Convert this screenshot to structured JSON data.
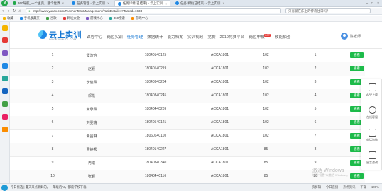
{
  "browser": {
    "tabs": [
      {
        "label": "360导航_一个主页，整个世界",
        "active": false,
        "color": "#22a84a"
      },
      {
        "label": "任务管理 - 云上实训",
        "active": false,
        "color": "#1e88e5"
      },
      {
        "label": "任务详情(已结束) - 云上实训",
        "active": true,
        "color": "#1e88e5"
      },
      {
        "label": "任务详情(已结束) - 云上实训",
        "active": false,
        "color": "#1e88e5"
      }
    ],
    "url": "http://www.yunsx.com/TeacherTaskManagement/TaskDetailes?TaskId=1033",
    "search_text": "只有躺在床上的传奇往日吗？"
  },
  "bookmarks": [
    "收藏",
    "手机收藏夹",
    "谷歌",
    "网址大全",
    "游戏中心",
    "360搜索",
    "游戏中心"
  ],
  "site": {
    "logo_text": "云上实训",
    "logo_url": "WWW.YUNSX.COM",
    "nav": [
      {
        "label": "课程中心",
        "active": false
      },
      {
        "label": "岗位实训",
        "active": false
      },
      {
        "label": "任务管理",
        "active": true
      },
      {
        "label": "数据统计",
        "active": false
      },
      {
        "label": "能力档案",
        "active": false
      },
      {
        "label": "实训视频",
        "active": false
      },
      {
        "label": "竞赛",
        "active": false
      },
      {
        "label": "2019竞赛平台",
        "active": false
      },
      {
        "label": "岗位申报",
        "active": false,
        "badge": "HOT"
      },
      {
        "label": "技能抽查",
        "active": false
      }
    ],
    "user_name": "陈老师"
  },
  "table": {
    "view_label": "查看",
    "rows": [
      {
        "idx": "1",
        "name": "谭浩怡",
        "id": "18040140125",
        "class": "ACCA1801",
        "score": "102",
        "num": "1"
      },
      {
        "idx": "2",
        "name": "赵颖",
        "id": "18040140219",
        "class": "ACCA1801",
        "score": "102",
        "num": "2"
      },
      {
        "idx": "3",
        "name": "李俊霖",
        "id": "18040340204",
        "class": "ACCA1801",
        "score": "102",
        "num": "3"
      },
      {
        "idx": "4",
        "name": "邓凯",
        "id": "18040340245",
        "class": "ACCA1801",
        "score": "102",
        "num": "4"
      },
      {
        "idx": "5",
        "name": "宋承霖",
        "id": "18040440209",
        "class": "ACCA1801",
        "score": "102",
        "num": "5"
      },
      {
        "idx": "6",
        "name": "刘雯瑞",
        "id": "18040540121",
        "class": "ACCA1801",
        "score": "102",
        "num": "6"
      },
      {
        "idx": "7",
        "name": "朱晶琳",
        "id": "18060640110",
        "class": "ACCA1801",
        "score": "102",
        "num": "7"
      },
      {
        "idx": "8",
        "name": "曹钟秀",
        "id": "18040140227",
        "class": "ACCA1801",
        "score": "85",
        "num": "8"
      },
      {
        "idx": "9",
        "name": "冉瑞",
        "id": "18040340340",
        "class": "ACCA1801",
        "score": "85",
        "num": "9"
      },
      {
        "idx": "10",
        "name": "张颖",
        "id": "18040440116",
        "class": "ACCA1801",
        "score": "85",
        "num": "10"
      }
    ]
  },
  "float_panel": [
    {
      "label": "APP下载",
      "icon": "phone-icon"
    },
    {
      "label": "在线客服",
      "icon": "headset-icon"
    },
    {
      "label": "电话咨询",
      "icon": "telephone-icon"
    },
    {
      "label": "留言咨询",
      "icon": "message-icon"
    }
  ],
  "watermark": {
    "title": "激活 Windows",
    "subtitle": "转到\"设置\"以激活 Windows。"
  },
  "statusbar": {
    "news": "今日优选 | 夏天来点新鲜的，一年级的AI，都被学校下载",
    "items": [
      "快剪辑",
      "今日直播",
      "热点资讯",
      "下载",
      "100%"
    ]
  }
}
